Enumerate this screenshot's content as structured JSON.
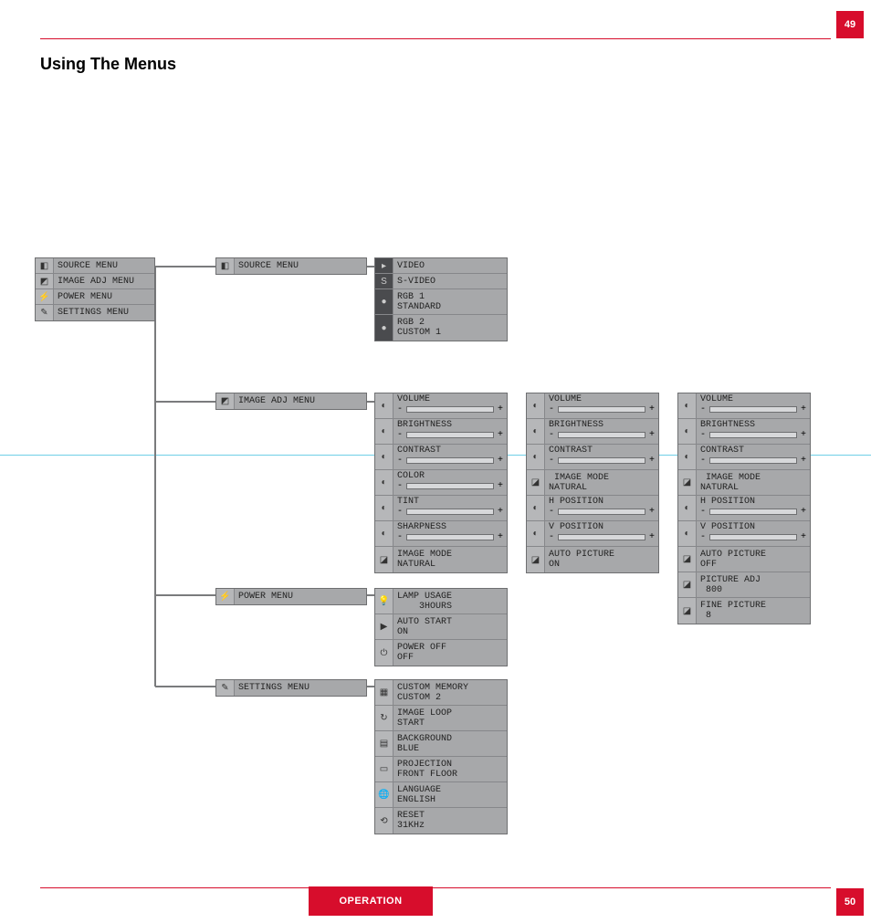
{
  "page": {
    "top_number": "49",
    "bottom_number": "50",
    "footer_label": "OPERATION",
    "heading": "Using The Menus"
  },
  "main_menu": {
    "items": [
      {
        "icon": "source-icon",
        "label": "SOURCE MENU"
      },
      {
        "icon": "image-adj-icon",
        "label": "IMAGE ADJ MENU"
      },
      {
        "icon": "power-icon",
        "label": "POWER MENU"
      },
      {
        "icon": "settings-icon",
        "label": "SETTINGS MENU"
      }
    ]
  },
  "source_menu_header": {
    "icon": "source-icon",
    "label": "SOURCE MENU"
  },
  "source_options": [
    {
      "icon": "video-icon",
      "label": "VIDEO"
    },
    {
      "icon": "svideo-icon",
      "label": "S-VIDEO"
    },
    {
      "icon": "rgb-icon",
      "label": "RGB 1\nSTANDARD"
    },
    {
      "icon": "rgb-icon",
      "label": "RGB 2\nCUSTOM 1"
    }
  ],
  "image_adj_header": {
    "icon": "image-adj-icon",
    "label": "IMAGE ADJ MENU"
  },
  "image_adj_1": {
    "sliders": [
      {
        "icon": "volume-icon",
        "label": "VOLUME"
      },
      {
        "icon": "brightness-icon",
        "label": "BRIGHTNESS"
      },
      {
        "icon": "contrast-icon",
        "label": "CONTRAST"
      },
      {
        "icon": "color-icon",
        "label": "COLOR"
      },
      {
        "icon": "tint-icon",
        "label": "TINT"
      },
      {
        "icon": "sharpness-icon",
        "label": "SHARPNESS"
      }
    ],
    "mode": {
      "icon": "mode-icon",
      "label": "IMAGE MODE\nNATURAL"
    }
  },
  "image_adj_2": {
    "sliders": [
      {
        "icon": "volume-icon",
        "label": "VOLUME"
      },
      {
        "icon": "brightness-icon",
        "label": "BRIGHTNESS"
      },
      {
        "icon": "contrast-icon",
        "label": "CONTRAST"
      }
    ],
    "mode1": {
      "icon": "mode-icon",
      "label": " IMAGE MODE\nNATURAL"
    },
    "sliders2": [
      {
        "icon": "hpos-icon",
        "label": "H POSITION"
      },
      {
        "icon": "vpos-icon",
        "label": "V POSITION"
      }
    ],
    "auto": {
      "icon": "auto-icon",
      "label": "AUTO PICTURE\nON"
    }
  },
  "image_adj_3": {
    "sliders": [
      {
        "icon": "volume-icon",
        "label": "VOLUME"
      },
      {
        "icon": "brightness-icon",
        "label": "BRIGHTNESS"
      },
      {
        "icon": "contrast-icon",
        "label": "CONTRAST"
      }
    ],
    "mode1": {
      "icon": "mode-icon",
      "label": " IMAGE MODE\nNATURAL"
    },
    "sliders2": [
      {
        "icon": "hpos-icon",
        "label": "H POSITION"
      },
      {
        "icon": "vpos-icon",
        "label": "V POSITION"
      }
    ],
    "auto": {
      "icon": "auto-icon",
      "label": "AUTO PICTURE\nOFF"
    },
    "picadj": {
      "icon": "picadj-icon",
      "label": "PICTURE ADJ\n 800"
    },
    "fine": {
      "icon": "fine-icon",
      "label": "FINE PICTURE\n 8"
    }
  },
  "power_menu_header": {
    "icon": "power-icon",
    "label": "POWER MENU"
  },
  "power_options": [
    {
      "icon": "lamp-icon",
      "label": "LAMP USAGE\n    3HOURS"
    },
    {
      "icon": "autostart-icon",
      "label": "AUTO START\nON"
    },
    {
      "icon": "poweroff-icon",
      "label": "POWER OFF\nOFF"
    }
  ],
  "settings_menu_header": {
    "icon": "settings-icon",
    "label": "SETTINGS MENU"
  },
  "settings_options": [
    {
      "icon": "memory-icon",
      "label": "CUSTOM MEMORY\nCUSTOM 2"
    },
    {
      "icon": "loop-icon",
      "label": "IMAGE LOOP\nSTART"
    },
    {
      "icon": "background-icon",
      "label": "BACKGROUND\nBLUE"
    },
    {
      "icon": "projection-icon",
      "label": "PROJECTION\nFRONT FLOOR"
    },
    {
      "icon": "language-icon",
      "label": "LANGUAGE\nENGLISH"
    },
    {
      "icon": "reset-icon",
      "label": "RESET\n31KHz"
    }
  ]
}
